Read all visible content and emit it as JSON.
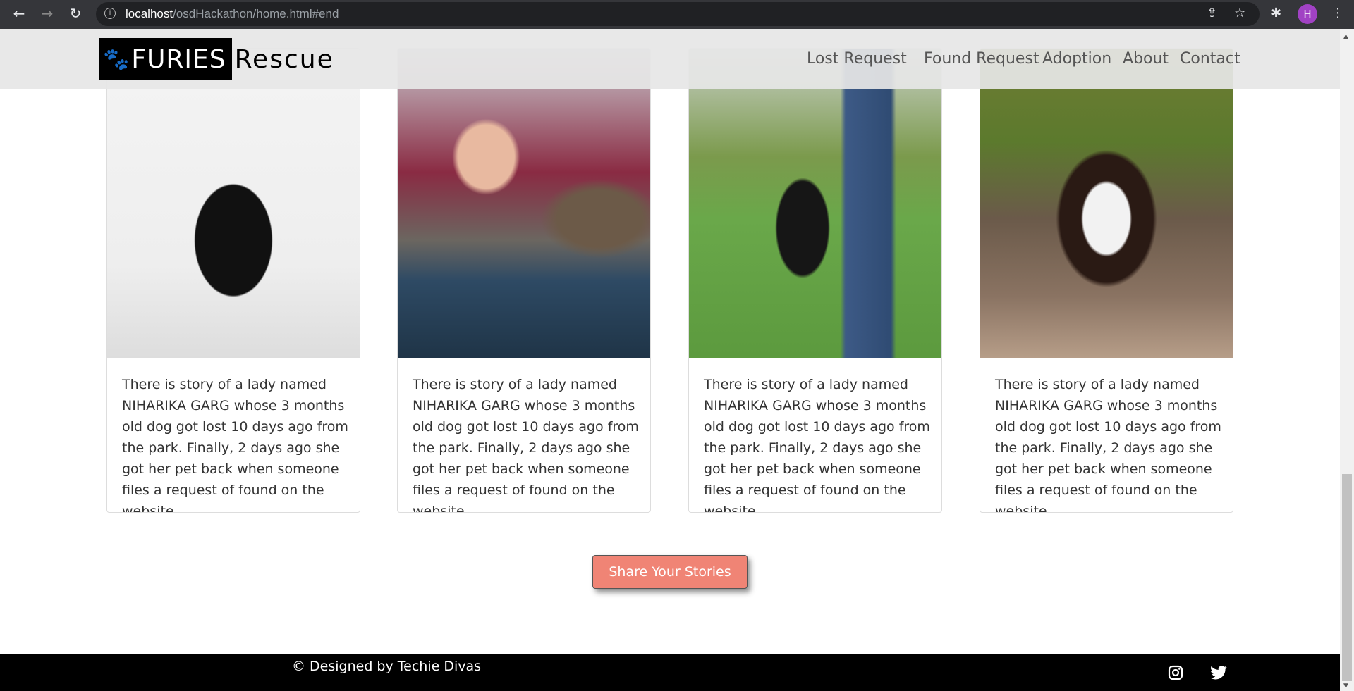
{
  "browser": {
    "url_host": "localhost",
    "url_path": "/osdHackathon/home.html#end",
    "profile_initial": "H"
  },
  "header": {
    "logo_box": "FURIES",
    "logo_rest": "Rescue",
    "nav": [
      "Lost Request",
      "Found Request",
      "Adoption",
      "About",
      "Contact"
    ]
  },
  "stories": [
    {
      "image": "black puppy",
      "text": "There is story of a lady named NIHARIKA GARG whose 3 months old dog got lost 10 days ago from the park. Finally, 2 days ago she got her pet back when someone files a request of found on the website."
    },
    {
      "image": "cat high five",
      "text": "There is story of a lady named NIHARIKA GARG whose 3 months old dog got lost 10 days ago from the park. Finally, 2 days ago she got her pet back when someone files a request of found on the website."
    },
    {
      "image": "dog on grass",
      "text": "There is story of a lady named NIHARIKA GARG whose 3 months old dog got lost 10 days ago from the park. Finally, 2 days ago she got her pet back when someone files a request of found on the website."
    },
    {
      "image": "border collie puppy",
      "text": "There is story of a lady named NIHARIKA GARG whose 3 months old dog got lost 10 days ago from the park. Finally, 2 days ago she got her pet back when someone files a request of found on the website."
    }
  ],
  "share_button": "Share Your Stories",
  "footer": {
    "copyright": "© Designed by Techie Divas"
  },
  "colors": {
    "accent": "#f08475",
    "footer": "#000000"
  }
}
